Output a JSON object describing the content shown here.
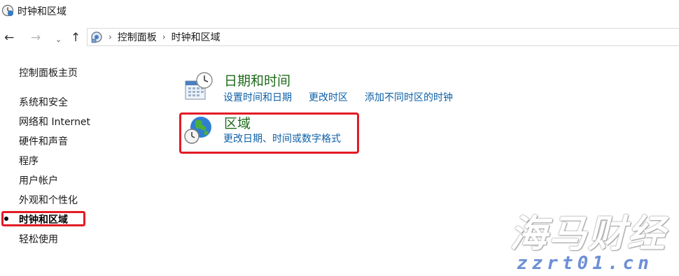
{
  "window": {
    "title": "时钟和区域"
  },
  "nav": {
    "back_icon": "←",
    "forward_icon": "→",
    "recent_icon": "⌄",
    "up_icon": "↑"
  },
  "address": {
    "separator": "›",
    "crumbs": [
      "控制面板",
      "时钟和区域"
    ]
  },
  "sidebar": {
    "home": "控制面板主页",
    "items": [
      {
        "label": "系统和安全"
      },
      {
        "label": "网络和 Internet"
      },
      {
        "label": "硬件和声音"
      },
      {
        "label": "程序"
      },
      {
        "label": "用户帐户"
      },
      {
        "label": "外观和个性化"
      },
      {
        "label": "时钟和区域",
        "active": true
      },
      {
        "label": "轻松使用"
      }
    ]
  },
  "categories": [
    {
      "title": "日期和时间",
      "icon": "calendar-clock-icon",
      "links": [
        "设置时间和日期",
        "更改时区",
        "添加不同时区的时钟"
      ]
    },
    {
      "title": "区域",
      "icon": "globe-clock-icon",
      "links": [
        "更改日期、时间或数字格式"
      ]
    }
  ],
  "watermark": {
    "text": "海马财经",
    "url": "zzrt01.cn"
  },
  "colors": {
    "highlight_box": "#e21b25",
    "category_title": "#1e6a19",
    "link": "#0c5fa6"
  }
}
